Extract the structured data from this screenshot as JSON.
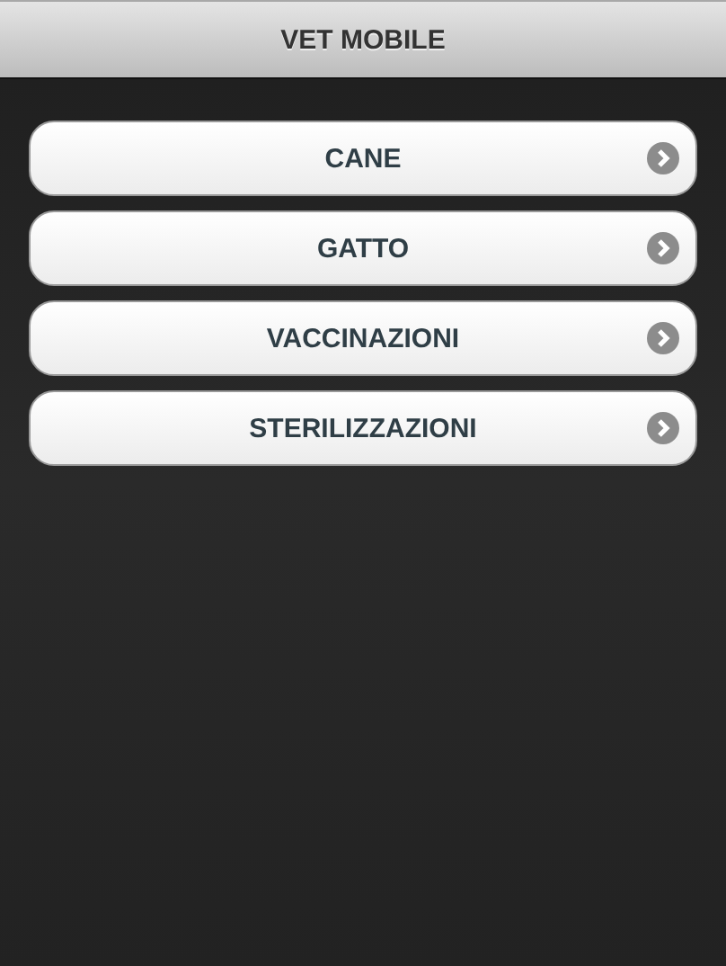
{
  "header": {
    "title": "VET MOBILE"
  },
  "menu": [
    {
      "label": "CANE"
    },
    {
      "label": "GATTO"
    },
    {
      "label": "VACCINAZIONI"
    },
    {
      "label": "STERILIZZAZIONI"
    }
  ]
}
